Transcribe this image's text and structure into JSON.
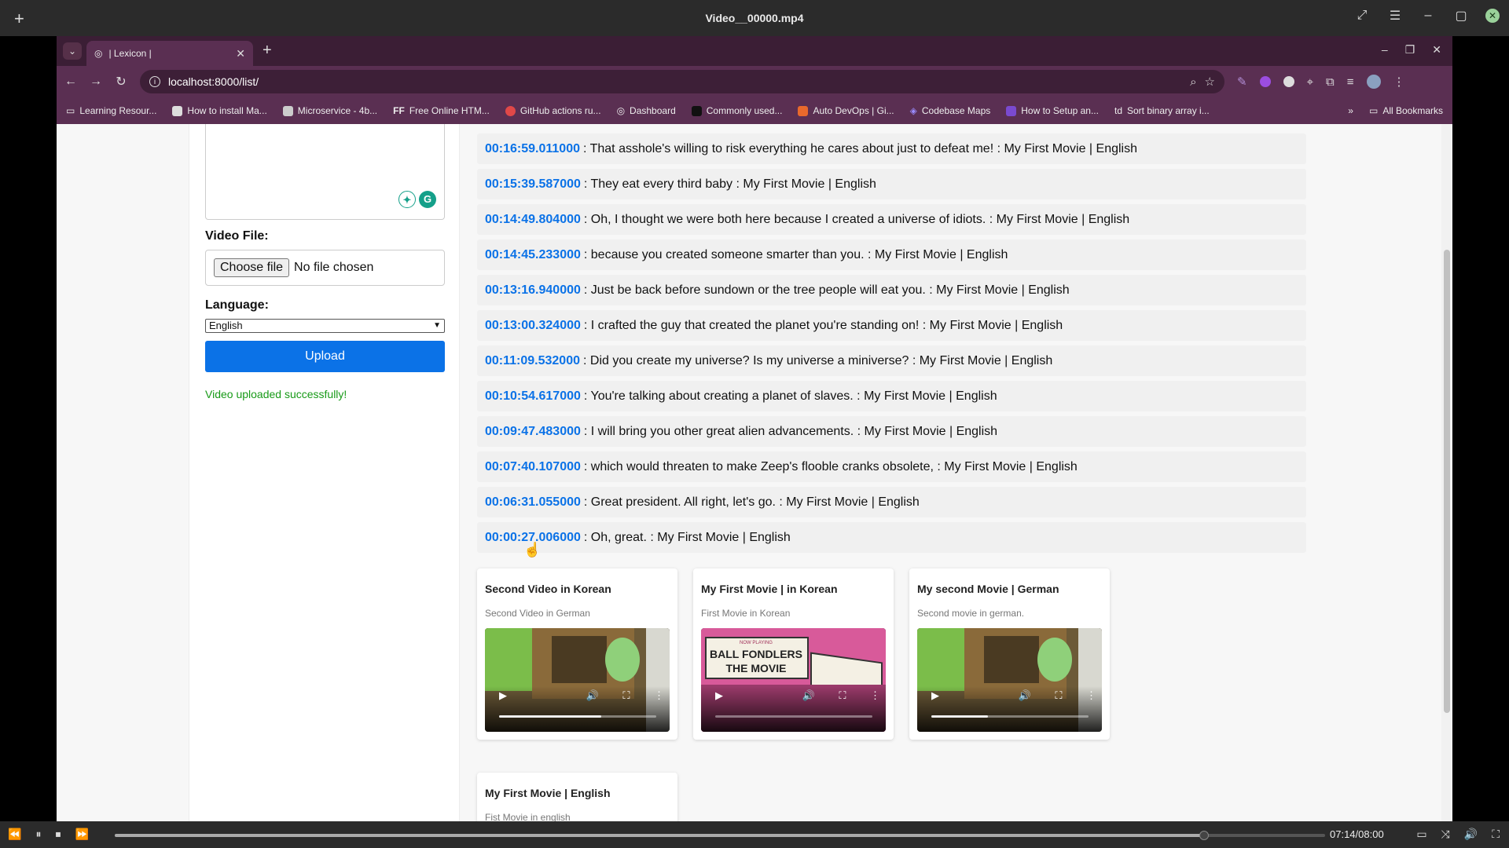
{
  "player": {
    "title": "Video__00000.mp4",
    "time": "07:14/08:00",
    "progress": 0.9
  },
  "browser": {
    "tab_title": "| Lexicon |",
    "url": "localhost:8000/list/",
    "bookmarks": [
      "Learning Resour...",
      "How to install Ma...",
      "Microservice - 4b...",
      "Free Online HTM...",
      "GitHub actions ru...",
      "Dashboard",
      "Commonly used...",
      "Auto DevOps | Gi...",
      "Codebase Maps",
      "How to Setup an...",
      "Sort binary array i..."
    ],
    "all_bookmarks": "All Bookmarks"
  },
  "form": {
    "video_file_label": "Video File:",
    "choose_file": "Choose file",
    "no_file": "No file chosen",
    "language_label": "Language:",
    "language_value": "English",
    "upload": "Upload",
    "success": "Video uploaded successfully!"
  },
  "subtitles": [
    {
      "ts": "00:16:59.011000",
      "text": ": That asshole's willing to risk everything he cares about just to defeat me! : My First Movie | English"
    },
    {
      "ts": "00:15:39.587000",
      "text": ": They eat every third baby : My First Movie | English"
    },
    {
      "ts": "00:14:49.804000",
      "text": ": Oh, I thought we were both here because I created a universe of idiots. : My First Movie | English"
    },
    {
      "ts": "00:14:45.233000",
      "text": ": because you created someone smarter than you. : My First Movie | English"
    },
    {
      "ts": "00:13:16.940000",
      "text": ": Just be back before sundown or the tree people will eat you. : My First Movie | English"
    },
    {
      "ts": "00:13:00.324000",
      "text": ": I crafted the guy that created the planet you're standing on! : My First Movie | English"
    },
    {
      "ts": "00:11:09.532000",
      "text": ": Did you create my universe? Is my universe a miniverse? : My First Movie | English"
    },
    {
      "ts": "00:10:54.617000",
      "text": ": You're talking about creating a planet of slaves. : My First Movie | English"
    },
    {
      "ts": "00:09:47.483000",
      "text": ": I will bring you other great alien advancements. : My First Movie | English"
    },
    {
      "ts": "00:07:40.107000",
      "text": ": which would threaten to make Zeep's flooble cranks obsolete, : My First Movie | English"
    },
    {
      "ts": "00:06:31.055000",
      "text": ": Great president. All right, let's go. : My First Movie | English"
    },
    {
      "ts": "00:00:27.006000",
      "text": ": Oh, great. : My First Movie | English"
    }
  ],
  "videos": [
    {
      "title": "Second Video in Korean",
      "desc": "Second Video in German",
      "progress": 0.65
    },
    {
      "title": "My First Movie | in Korean",
      "desc": "First Movie in Korean",
      "progress": 0.0,
      "poster_line1": "BALL FONDLERS",
      "poster_line2": "THE MOVIE",
      "poster_top": "NOW PLAYING"
    },
    {
      "title": "My second Movie | German",
      "desc": "Second movie in german.",
      "progress": 0.36
    },
    {
      "title": "My First Movie | English",
      "desc": "Fist Movie in english"
    }
  ],
  "colors": {
    "accent": "#0b72e7",
    "success": "#179a17",
    "browser_frame": "#5a2f52"
  }
}
